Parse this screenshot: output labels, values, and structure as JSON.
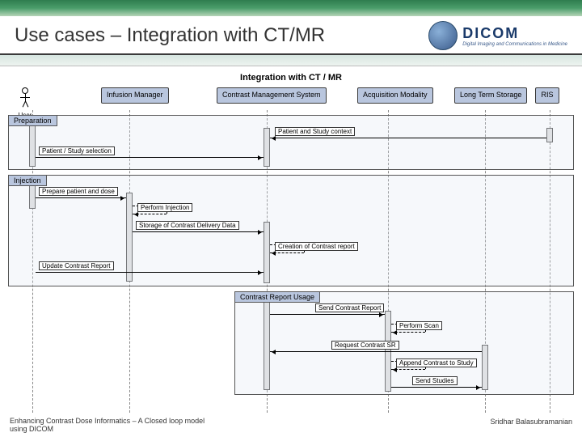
{
  "header": {
    "title": "Use cases – Integration with CT/MR",
    "logo_main": "DICOM",
    "logo_sub": "Digital Imaging and Communications in Medicine"
  },
  "diagram": {
    "title": "Integration with CT / MR",
    "actors": {
      "user": "User",
      "infusion": "Infusion\nManager",
      "cms": "Contrast Management\nSystem",
      "modality": "Acquisition\nModality",
      "storage": "Long Term\nStorage",
      "ris": "RIS"
    },
    "phases": {
      "prep": "Preparation",
      "inj": "Injection",
      "usage": "Contrast Report Usage"
    },
    "messages": {
      "m1": "Patient and Study context",
      "m2": "Patient / Study selection",
      "m3": "Prepare patient and dose",
      "m4": "Perform Injection",
      "m5": "Storage of Contrast Delivery Data",
      "m6": "Creation of Contrast report",
      "m7": "Update Contrast Report",
      "m8": "Send Contrast Report",
      "m9": "Perform Scan",
      "m10": "Request Contrast SR",
      "m11": "Append Contrast to Study",
      "m12": "Send Studies"
    }
  },
  "footer": {
    "left": "Enhancing Contrast Dose Informatics – A Closed loop model using DICOM",
    "right": "Sridhar Balasubramanian"
  },
  "lanes_x": {
    "user": 30,
    "infusion": 150,
    "cms": 320,
    "modality": 470,
    "storage": 590,
    "ris": 670
  }
}
